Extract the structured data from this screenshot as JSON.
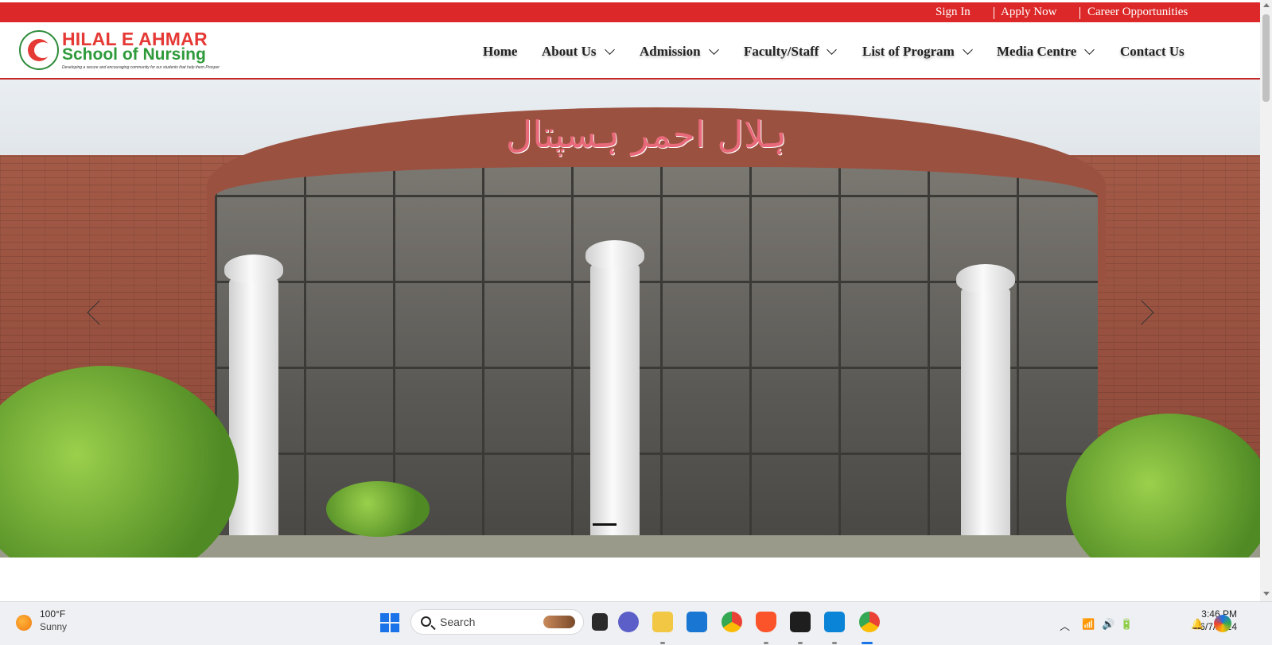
{
  "topbar": {
    "sign_in": "Sign In",
    "apply_now": "Apply Now",
    "career": "Career Opportunities"
  },
  "logo": {
    "title": "HILAL E AHMAR",
    "subtitle": "School of Nursing",
    "tagline": "Developing a secure and encouraging community for our students that help them Prosper"
  },
  "nav": {
    "home": "Home",
    "about": "About Us",
    "admission": "Admission",
    "faculty": "Faculty/Staff",
    "programs": "List of Program",
    "media": "Media Centre",
    "contact": "Contact Us"
  },
  "hero": {
    "urdu_sign": "ہلال احمر ہسپتال"
  },
  "taskbar": {
    "weather_temp": "100°F",
    "weather_desc": "Sunny",
    "search_placeholder": "Search",
    "time": "3:46 PM",
    "date": "6/7/2024"
  },
  "colors": {
    "brand_red": "#dc2828",
    "brand_green": "#2e9a3a"
  }
}
